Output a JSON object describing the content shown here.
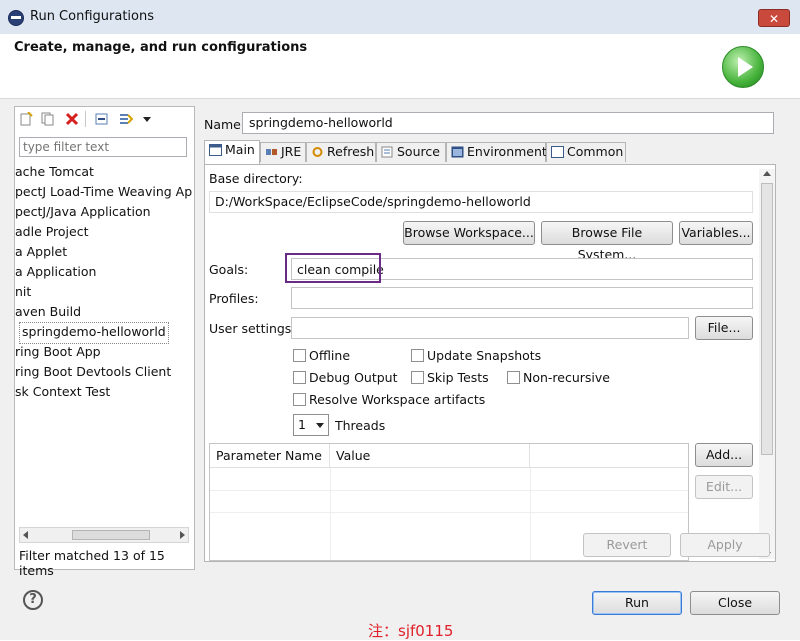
{
  "window": {
    "title": "Run Configurations"
  },
  "header": {
    "title": "Create, manage, and run configurations",
    "run_icon": "run-play-icon"
  },
  "left": {
    "toolbar_icons": [
      "new-config-icon",
      "duplicate-icon",
      "delete-icon",
      "collapse-all-icon",
      "filter-icon",
      "dropdown-arrow-icon"
    ],
    "filter_placeholder": "type filter text",
    "items": [
      "ache Tomcat",
      "pectJ Load-Time Weaving Ap",
      "pectJ/Java Application",
      "adle Project",
      "a Applet",
      "a Application",
      "nit",
      "aven Build",
      "springdemo-helloworld",
      "ring Boot App",
      "ring Boot Devtools Client",
      "sk Context Test"
    ],
    "selected_index": 8,
    "status": "Filter matched 13 of 15 items"
  },
  "right": {
    "name_label": "Name:",
    "name_value": "springdemo-helloworld",
    "tabs": [
      {
        "label": "Main",
        "icon": "main-tab-icon"
      },
      {
        "label": "JRE",
        "icon": "jre-icon"
      },
      {
        "label": "Refresh",
        "icon": "refresh-icon"
      },
      {
        "label": "Source",
        "icon": "source-icon"
      },
      {
        "label": "Environment",
        "icon": "environment-icon"
      },
      {
        "label": "Common",
        "icon": "common-icon"
      }
    ],
    "base_dir_label": "Base directory:",
    "base_dir_value": "D:/WorkSpace/EclipseCode/springdemo-helloworld",
    "browse_workspace": "Browse Workspace...",
    "browse_fs": "Browse File System...",
    "variables": "Variables...",
    "goals_label": "Goals:",
    "goals_value": "clean compile",
    "profiles_label": "Profiles:",
    "profiles_value": "",
    "user_settings_label": "User settings:",
    "user_settings_value": "",
    "file_button": "File...",
    "checks": {
      "offline": "Offline",
      "update_snapshots": "Update Snapshots",
      "debug_output": "Debug Output",
      "skip_tests": "Skip Tests",
      "non_recursive": "Non-recursive",
      "resolve_workspace": "Resolve Workspace artifacts"
    },
    "threads_value": "1",
    "threads_label": "Threads",
    "param_headers": [
      "Parameter Name",
      "Value"
    ],
    "add_button": "Add...",
    "edit_button": "Edit...",
    "revert": "Revert",
    "apply": "Apply"
  },
  "footer": {
    "run": "Run",
    "close": "Close",
    "help_glyph": "?",
    "watermark": "注：sjf0115"
  }
}
